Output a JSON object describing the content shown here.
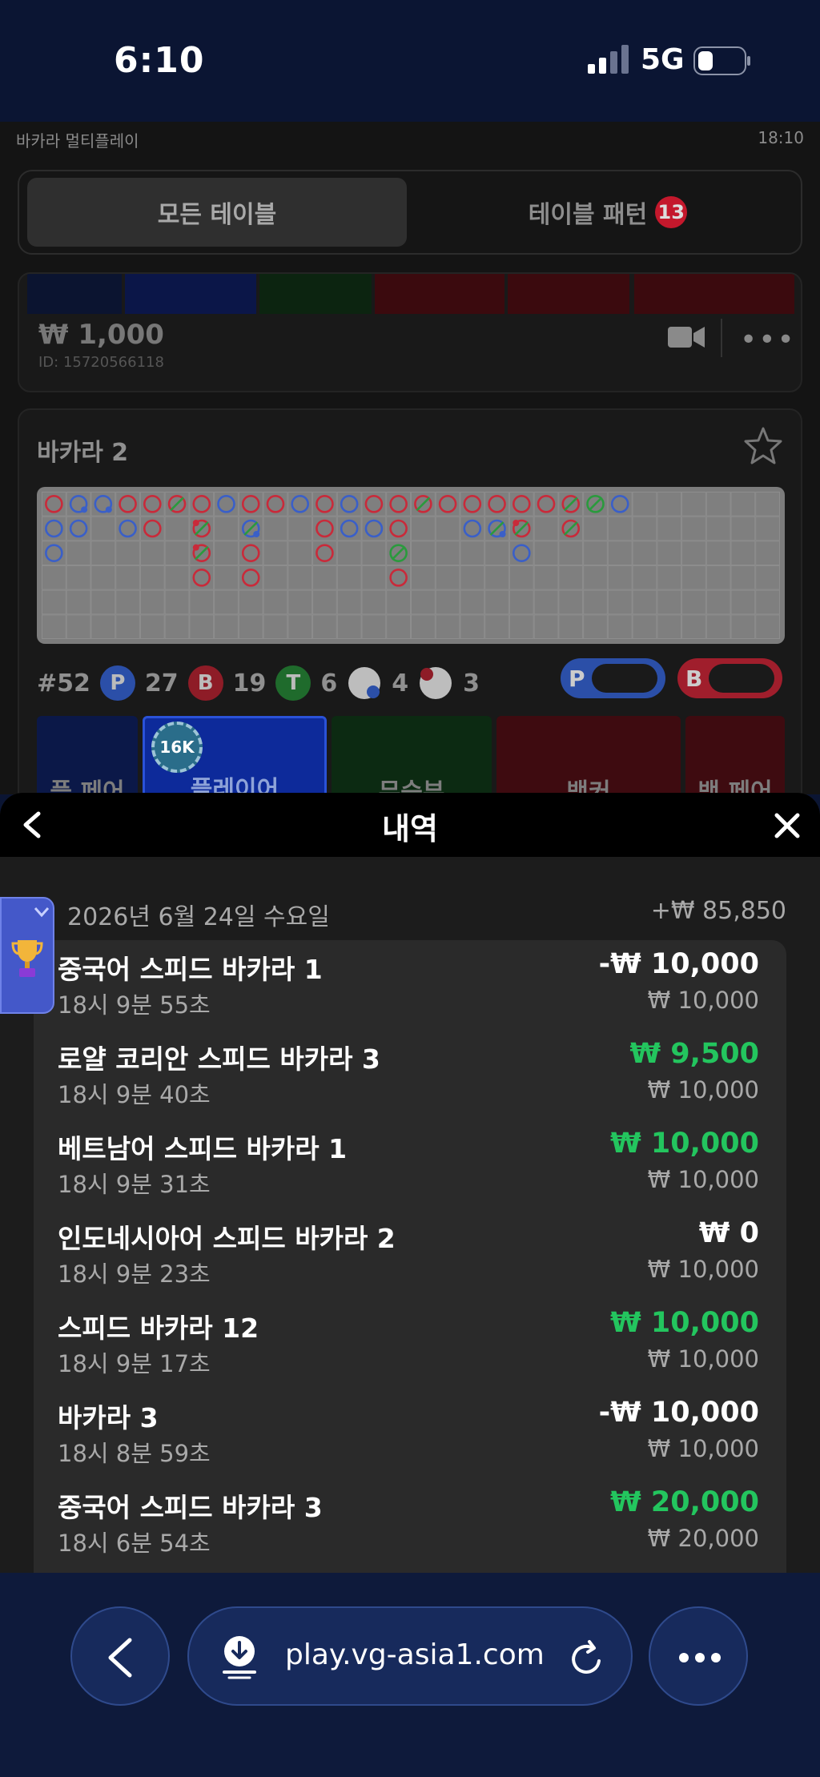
{
  "status_bar": {
    "time": "6:10",
    "network": "5G"
  },
  "game": {
    "app_name": "바카라 멀티플레이",
    "clock": "18:10",
    "tabs": [
      {
        "label": "모든 테이블",
        "active": true
      },
      {
        "label": "테이블 패턴",
        "badge": "13",
        "active": false
      }
    ],
    "prev_table": {
      "amount": "₩ 1,000",
      "table_id": "ID: 15720566118"
    },
    "table": {
      "title": "바카라 2",
      "round": "#52",
      "stats": {
        "player": {
          "letter": "P",
          "count": "27"
        },
        "banker": {
          "letter": "B",
          "count": "19"
        },
        "tie": {
          "letter": "T",
          "count": "6"
        },
        "player_pair": "4",
        "banker_pair": "3"
      },
      "predict": {
        "player": "P",
        "banker": "B"
      },
      "bets": {
        "player_pair": "플 페어",
        "player": "플레이어",
        "tie": "무승부",
        "banker": "뱅커",
        "banker_pair": "뱅 페어",
        "chip": "16K"
      }
    }
  },
  "history": {
    "title": "내역",
    "date": "2026년 6월 24일 수요일",
    "day_total": "+₩ 85,850",
    "rows": [
      {
        "name": "중국어 스피드 바카라 1",
        "time": "18시 9분 55초",
        "result": "-₩ 10,000",
        "stake": "₩ 10,000",
        "win": false
      },
      {
        "name": "로얄 코리안 스피드 바카라 3",
        "time": "18시 9분 40초",
        "result": "₩ 9,500",
        "stake": "₩ 10,000",
        "win": true
      },
      {
        "name": "베트남어 스피드 바카라 1",
        "time": "18시 9분 31초",
        "result": "₩ 10,000",
        "stake": "₩ 10,000",
        "win": true
      },
      {
        "name": "인도네시아어 스피드 바카라 2",
        "time": "18시 9분 23초",
        "result": "₩ 0",
        "stake": "₩ 10,000",
        "win": false
      },
      {
        "name": "스피드 바카라 12",
        "time": "18시 9분 17초",
        "result": "₩ 10,000",
        "stake": "₩ 10,000",
        "win": true
      },
      {
        "name": "바카라 3",
        "time": "18시 8분 59초",
        "result": "-₩ 10,000",
        "stake": "₩ 10,000",
        "win": false
      },
      {
        "name": "중국어 스피드 바카라 3",
        "time": "18시 6분 54초",
        "result": "₩ 20,000",
        "stake": "₩ 20,000",
        "win": true
      }
    ]
  },
  "browser": {
    "url": "play.vg-asia1.com"
  },
  "colors": {
    "win": "#23c55e",
    "player": "#2d5fd6",
    "banker": "#d0263a",
    "tie": "#2a9a3d",
    "accent": "#4458c9"
  },
  "road": {
    "columns": [
      [
        "B",
        "P",
        "P"
      ],
      [
        "Pd",
        "P"
      ],
      [
        "Pd"
      ],
      [
        "B",
        "P"
      ],
      [
        "B",
        "B"
      ],
      [
        "Bt"
      ],
      [
        "B",
        "Bdot",
        "Bdot",
        "B"
      ],
      [
        "P"
      ],
      [
        "B",
        "Pdot",
        "B",
        "B"
      ],
      [
        "B"
      ],
      [
        "P"
      ],
      [
        "B",
        "B",
        "B"
      ],
      [
        "P",
        "P"
      ],
      [
        "B",
        "P"
      ],
      [
        "B",
        "B",
        "Gt",
        "B"
      ],
      [
        "Bt"
      ],
      [
        "B"
      ],
      [
        "B",
        "P"
      ],
      [
        "B",
        "Pdot2"
      ],
      [
        "B",
        "Bdot",
        "P"
      ],
      [
        "B"
      ],
      [
        "Bt",
        "Bt"
      ],
      [
        "Gt"
      ],
      [
        "P"
      ]
    ]
  }
}
